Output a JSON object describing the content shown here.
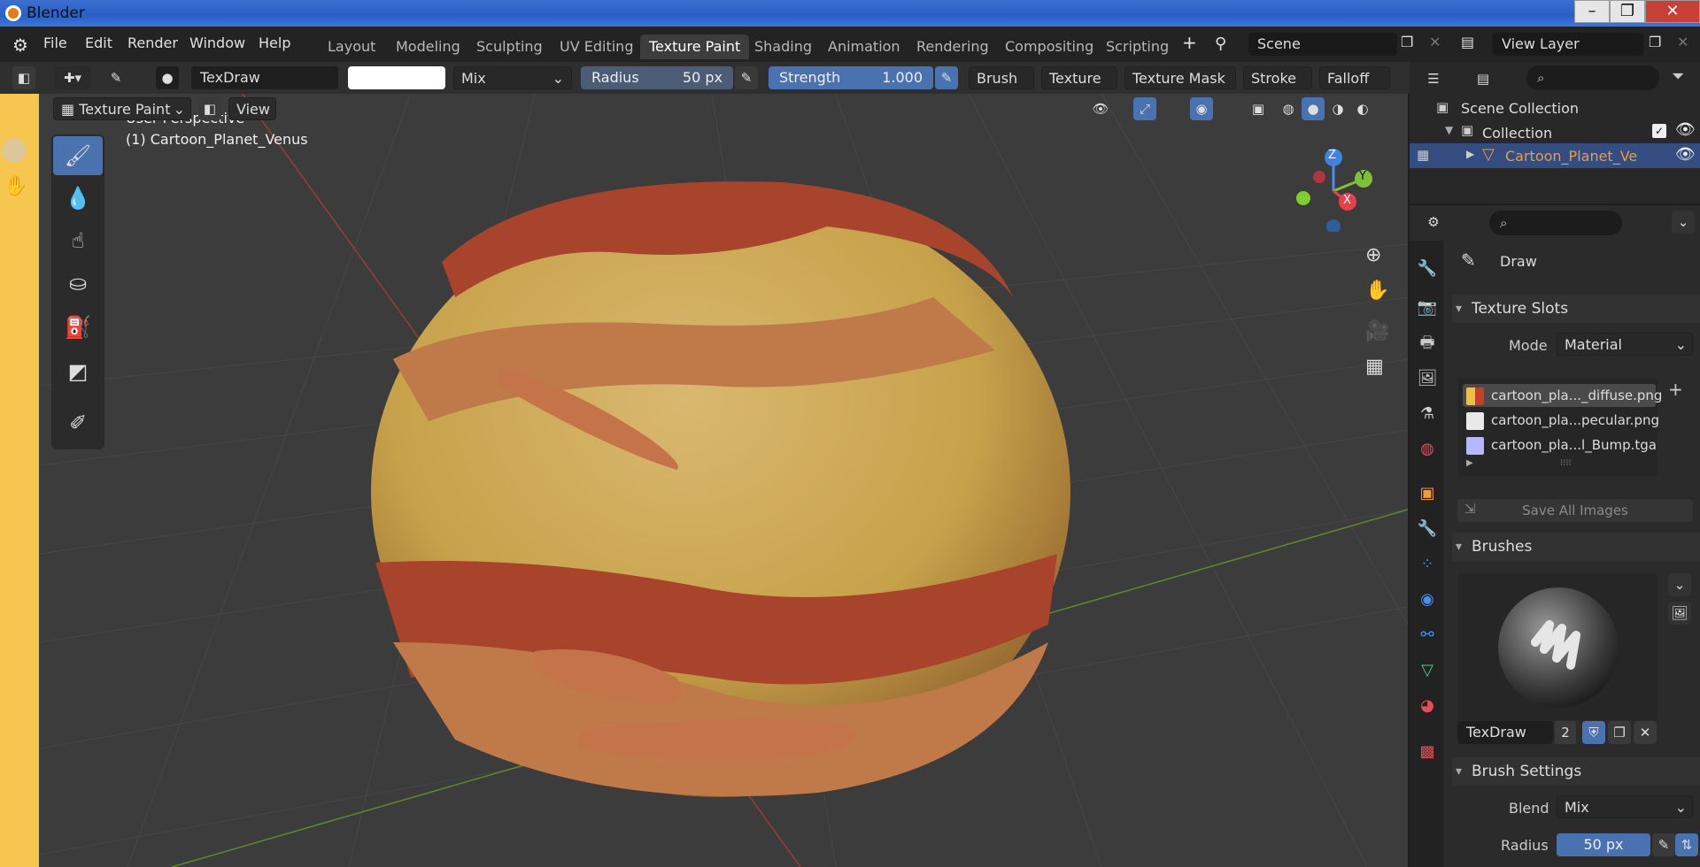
{
  "window": {
    "title": "Blender"
  },
  "menu": [
    "File",
    "Edit",
    "Render",
    "Window",
    "Help"
  ],
  "workspace_tabs": [
    {
      "label": "Layout"
    },
    {
      "label": "Modeling"
    },
    {
      "label": "Sculpting"
    },
    {
      "label": "UV Editing"
    },
    {
      "label": "Texture Paint",
      "active": true
    },
    {
      "label": "Shading"
    },
    {
      "label": "Animation"
    },
    {
      "label": "Rendering"
    },
    {
      "label": "Compositing"
    },
    {
      "label": "Scripting"
    }
  ],
  "scene": "Scene",
  "view_layer": "View Layer",
  "tool_header": {
    "brush_name": "TexDraw",
    "blend": "Mix",
    "radius_label": "Radius",
    "radius_value": "50 px",
    "strength_label": "Strength",
    "strength_value": "1.000",
    "menus": [
      "Brush",
      "Texture",
      "Texture Mask",
      "Stroke",
      "Falloff"
    ]
  },
  "viewport_header": {
    "mode": "Texture Paint",
    "view": "View"
  },
  "viewport": {
    "perspective": "User Perspective",
    "object": "(1) Cartoon_Planet_Venus"
  },
  "gizmo": {
    "x": "X",
    "y": "Y",
    "z": "Z"
  },
  "outliner": {
    "root": "Scene Collection",
    "collection": "Collection",
    "object": "Cartoon_Planet_Venu"
  },
  "properties": {
    "tool_name": "Draw",
    "texture_slots": {
      "title": "Texture Slots",
      "mode_label": "Mode",
      "mode_value": "Material",
      "slots": [
        {
          "name": "cartoon_pla..._diffuse.png",
          "color": "#e8c04a",
          "active": true
        },
        {
          "name": "cartoon_pla...pecular.png",
          "color": "#e9e9e9"
        },
        {
          "name": "cartoon_pla...l_Bump.tga",
          "color": "#b7b7ff"
        }
      ],
      "save_all": "Save All Images"
    },
    "brushes": {
      "title": "Brushes",
      "brush_name": "TexDraw",
      "users": "2"
    },
    "brush_settings": {
      "title": "Brush Settings",
      "blend_label": "Blend",
      "blend_value": "Mix",
      "radius_label": "Radius",
      "radius_value": "50 px"
    }
  },
  "colors": {
    "accent": "#4a72b0",
    "selected_text": "#f09a3a"
  }
}
